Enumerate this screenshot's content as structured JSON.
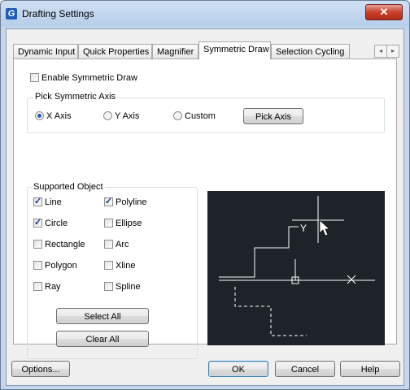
{
  "window": {
    "title": "Drafting Settings",
    "close_glyph": "✕",
    "app_icon_glyph": "G"
  },
  "tabs": [
    {
      "label": "Dynamic Input",
      "active": false
    },
    {
      "label": "Quick Properties",
      "active": false
    },
    {
      "label": "Magnifier",
      "active": false
    },
    {
      "label": "Symmetric Draw",
      "active": true
    },
    {
      "label": "Selection Cycling",
      "active": false
    }
  ],
  "tab_scroll": {
    "left_glyph": "◂",
    "right_glyph": "▸"
  },
  "enable_symmetric": {
    "label": "Enable Symmetric Draw",
    "checked": false
  },
  "pick_axis": {
    "title": "Pick Symmetric Axis",
    "options": [
      {
        "label": "X Axis",
        "selected": true
      },
      {
        "label": "Y Axis",
        "selected": false
      },
      {
        "label": "Custom",
        "selected": false
      }
    ],
    "button": "Pick Axis"
  },
  "supported_object": {
    "title": "Supported Object",
    "items": [
      {
        "label": "Line",
        "checked": true
      },
      {
        "label": "Polyline",
        "checked": true
      },
      {
        "label": "Circle",
        "checked": true
      },
      {
        "label": "Ellipse",
        "checked": false
      },
      {
        "label": "Rectangle",
        "checked": false
      },
      {
        "label": "Arc",
        "checked": false
      },
      {
        "label": "Polygon",
        "checked": false
      },
      {
        "label": "Xline",
        "checked": false
      },
      {
        "label": "Ray",
        "checked": false
      },
      {
        "label": "Spline",
        "checked": false
      }
    ],
    "select_all": "Select All",
    "clear_all": "Clear All"
  },
  "preview": {
    "y_label": "Y"
  },
  "footer": {
    "options": "Options...",
    "ok": "OK",
    "cancel": "Cancel",
    "help": "Help"
  },
  "colors": {
    "preview_bg": "#1e2329",
    "preview_lines": "#ffffff"
  }
}
